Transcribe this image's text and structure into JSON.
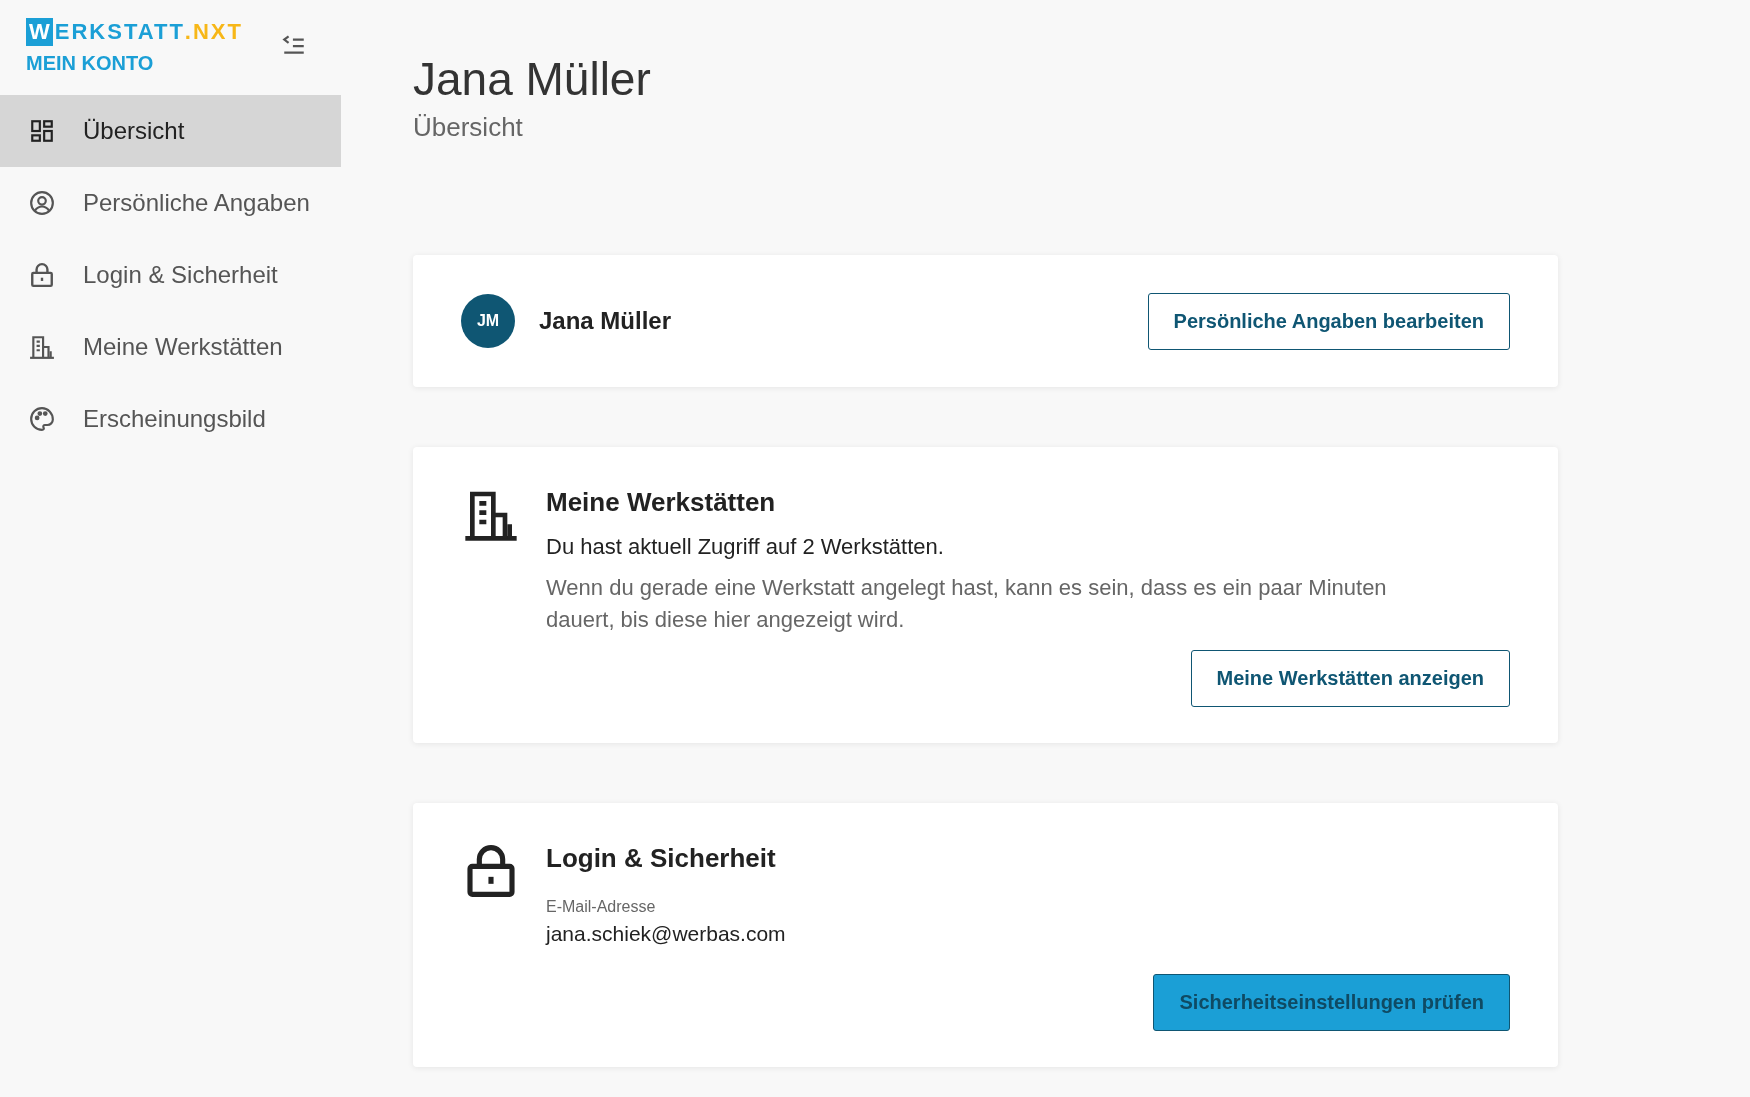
{
  "logo": {
    "initial": "W",
    "name": "ERKSTATT",
    "suffix": ".NXT",
    "subtitle": "MEIN KONTO"
  },
  "sidebar": {
    "items": [
      {
        "label": "Übersicht",
        "kind": "dashboard",
        "selected": true
      },
      {
        "label": "Persönliche Angaben",
        "kind": "person",
        "selected": false
      },
      {
        "label": "Login & Sicherheit",
        "kind": "lock",
        "selected": false
      },
      {
        "label": "Meine Werkstätten",
        "kind": "building",
        "selected": false
      },
      {
        "label": "Erscheinungsbild",
        "kind": "palette",
        "selected": false
      }
    ]
  },
  "header": {
    "title": "Jana Müller",
    "subtitle": "Übersicht"
  },
  "cards": [
    {
      "kind": "profile",
      "initials": "JM",
      "name": "Jana Müller",
      "button": "Persönliche Angaben bearbeiten"
    },
    {
      "kind": "info",
      "title": "Meine Werkstätten",
      "text": "Du hast aktuell Zugriff auf 2 Werkstätten.",
      "note": "Wenn du gerade eine Werkstatt angelegt hast, kann es sein, dass es ein paar Minuten dauert, bis diese hier angezeigt wird.",
      "button": "Meine Werkstätten anzeigen",
      "primary": false
    },
    {
      "kind": "field",
      "title": "Login & Sicherheit",
      "field_label": "E-Mail-Adresse",
      "field_value": "jana.schiek@werbas.com",
      "button": "Sicherheitseinstellungen prüfen",
      "primary": true
    }
  ]
}
